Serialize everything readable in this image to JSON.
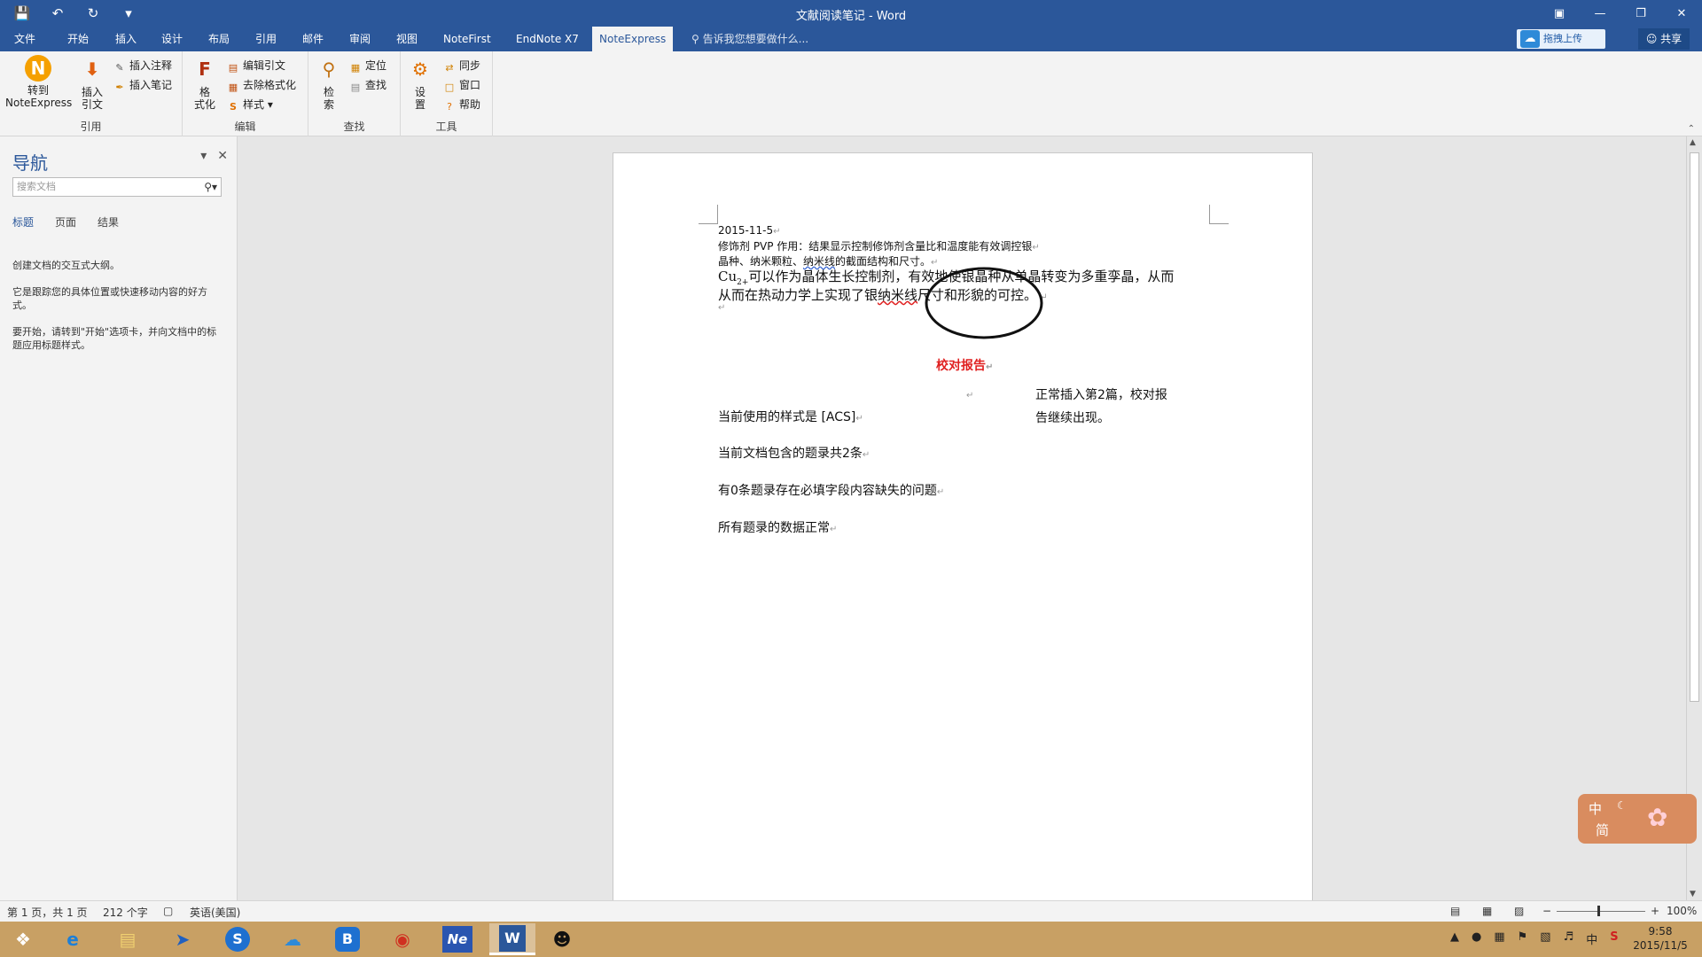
{
  "window": {
    "title": "文献阅读笔记 - Word"
  },
  "tabs": [
    {
      "label": "文件"
    },
    {
      "label": "开始"
    },
    {
      "label": "插入"
    },
    {
      "label": "设计"
    },
    {
      "label": "布局"
    },
    {
      "label": "引用"
    },
    {
      "label": "邮件"
    },
    {
      "label": "审阅"
    },
    {
      "label": "视图"
    },
    {
      "label": "NoteFirst"
    },
    {
      "label": "EndNote X7"
    },
    {
      "label": "NoteExpress"
    }
  ],
  "active_tab": "NoteExpress",
  "tell_me": "告诉我您想要做什么...",
  "upload_label": "拖拽上传",
  "share_label": "共享",
  "ribbon": {
    "groups": {
      "cite": {
        "label": "引用",
        "goto": "转到\nNoteExpress",
        "insert_cite": "插入\n引文",
        "insert_note": "插入注释",
        "insert_memo": "插入笔记"
      },
      "edit": {
        "label": "编辑",
        "format": "格\n式化",
        "edit_cite": "编辑引文",
        "remove_format": "去除格式化",
        "style": "样式"
      },
      "find": {
        "label": "查找",
        "search": "检\n索",
        "locate": "定位",
        "find": "查找"
      },
      "tools": {
        "label": "工具",
        "settings": "设\n置",
        "sync": "同步",
        "window": "窗口",
        "help": "帮助"
      }
    }
  },
  "nav": {
    "title": "导航",
    "search_placeholder": "搜索文档",
    "tabs": [
      "标题",
      "页面",
      "结果"
    ],
    "p1": "创建文档的交互式大纲。",
    "p2": "它是跟踪您的具体位置或快速移动内容的好方式。",
    "p3": "要开始，请转到\"开始\"选项卡，并向文档中的标题应用标题样式。"
  },
  "doc": {
    "date": "2015-11-5",
    "l1": "修饰剂 PVP 作用：结果显示控制修饰剂含量比和温度能有效调控银",
    "l2a": "晶种、纳米颗粒、",
    "l2b": "纳米线",
    "l2c": "的截面结构和尺寸。",
    "l3a": "Cu",
    "l3sup": "2+",
    "l3b": "可以作为晶体生长控制剂，有效地使银晶种从单晶转变为多重孪晶，从而",
    "l4a": "从而在热动力学上实现了银",
    "l4b": "纳米线",
    "l4c": "尺寸和形貌的可控。",
    "report_title": "校对报告",
    "note": "正常插入第2篇，校对报告继续出现。",
    "style_line": "当前使用的样式是 [ACS]",
    "count_line": "当前文档包含的题录共2条",
    "missing_line": "有0条题录存在必填字段内容缺失的问题",
    "ok_line": "所有题录的数据正常"
  },
  "ime": {
    "a": "中",
    "b": "简"
  },
  "status": {
    "page": "第 1 页，共 1 页",
    "words": "212 个字",
    "lang": "英语(美国)",
    "zoom": "100%"
  },
  "clock": {
    "time": "9:58",
    "date": "2015/11/5"
  },
  "colors": {
    "accent": "#2b579a",
    "taskbar": "#c8a064",
    "red": "#e02020"
  }
}
